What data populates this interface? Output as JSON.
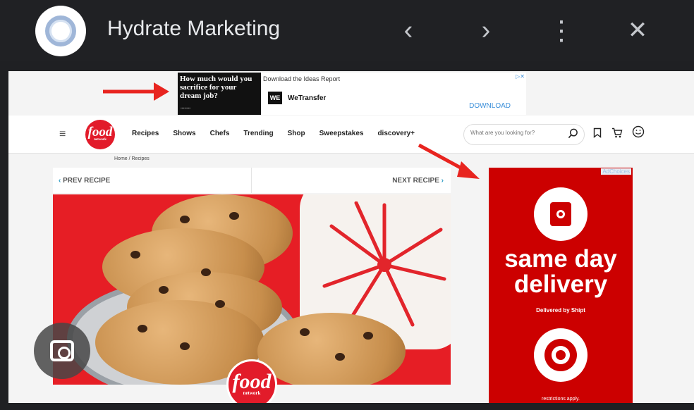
{
  "window": {
    "title": "Hydrate Marketing",
    "prev_glyph": "‹",
    "next_glyph": "›",
    "menu_glyph": "⋮",
    "close_glyph": "✕"
  },
  "top_ad": {
    "headline": "How much would you sacrifice for your dream job?",
    "report_text": "Download the Ideas Report",
    "brand": "WeTransfer",
    "brand_logo": "WE",
    "cta": "DOWNLOAD",
    "adchoice_glyph": "▷✕"
  },
  "site": {
    "logo_word": "food",
    "logo_sub": "network",
    "menu_glyph": "≡",
    "menu": [
      "Recipes",
      "Shows",
      "Chefs",
      "Trending",
      "Shop",
      "Sweepstakes",
      "discovery+"
    ],
    "search_placeholder": "What are you looking for?",
    "breadcrumb": "Home / Recipes",
    "prev_recipe": "PREV RECIPE",
    "next_recipe": "NEXT RECIPE"
  },
  "side_ad": {
    "adchoices": "AdChoices",
    "headline_line1": "same day",
    "headline_line2": "delivery",
    "delivered_by": "Delivered by Shipt",
    "restrictions": "restrictions apply."
  },
  "annotations": {
    "arrow_color": "#e8241f"
  },
  "colors": {
    "brand_red": "#e21b2a",
    "target_red": "#cc0000",
    "link_blue": "#2e9cc4"
  }
}
